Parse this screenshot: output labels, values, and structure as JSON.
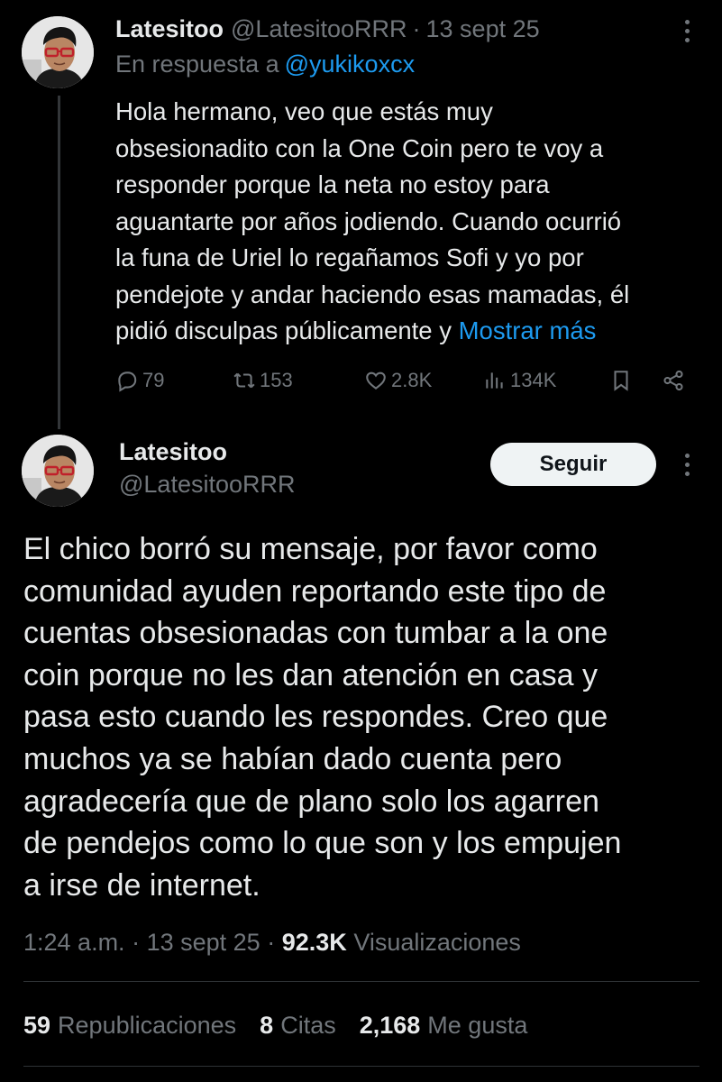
{
  "reply_tweet": {
    "author_name": "Latesitoo",
    "author_handle": "@LatesitooRRR",
    "separator": "·",
    "date": "13 sept 25",
    "replying_to_label": "En respuesta a",
    "replying_to_handle": "@yukikoxcx",
    "body_lines": [
      "Hola hermano, veo que estás muy",
      "obsesionadito con la One Coin pero te voy a",
      "responder porque la neta no estoy para",
      "aguantarte por años jodiendo. Cuando ocurrió",
      "la funa de Uriel lo regañamos Sofi y yo por",
      "pendejote y andar haciendo esas mamadas, él",
      "pidió disculpas públicamente y"
    ],
    "show_more": "Mostrar más",
    "metrics": {
      "replies": "79",
      "reposts": "153",
      "likes": "2.8K",
      "views": "134K"
    },
    "icons": [
      "reply-icon",
      "repost-icon",
      "like-icon",
      "views-icon",
      "bookmark-icon",
      "share-icon",
      "more-icon"
    ]
  },
  "main_tweet": {
    "author_name": "Latesitoo",
    "author_handle": "@LatesitooRRR",
    "follow_label": "Seguir",
    "body_lines": [
      "El chico borró su mensaje, por favor como",
      "comunidad ayuden reportando este tipo de",
      "cuentas obsesionadas con tumbar a la one",
      "coin porque no les dan atención en casa y",
      "pasa esto cuando les respondes. Creo que",
      "muchos ya se habían dado cuenta pero",
      "agradecería que de plano solo los agarren",
      "de pendejos como lo que son y los empujen",
      "a irse de internet."
    ],
    "time": "1:24 a.m.",
    "separator": "·",
    "date": "13 sept 25",
    "views_count": "92.3K",
    "views_label": "Visualizaciones",
    "stats": {
      "reposts_count": "59",
      "reposts_label": "Republicaciones",
      "quotes_count": "8",
      "quotes_label": "Citas",
      "likes_count": "2,168",
      "likes_label": "Me gusta"
    }
  },
  "colors": {
    "background": "#000000",
    "primary_text": "#e7e9ea",
    "secondary_text": "#71767b",
    "link": "#1d9bf0",
    "divider": "#2f3336",
    "follow_button_bg": "#eff3f4"
  }
}
